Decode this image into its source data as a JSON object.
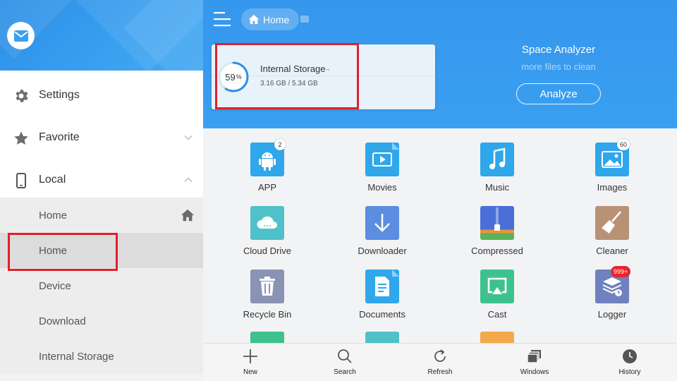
{
  "sidebar": {
    "items": [
      {
        "label": "Settings",
        "icon": "gear-icon"
      },
      {
        "label": "Favorite",
        "icon": "star-icon"
      },
      {
        "label": "Local",
        "icon": "phone-icon"
      }
    ],
    "local_children": [
      {
        "label": "Home"
      },
      {
        "label": "Home"
      },
      {
        "label": "Device"
      },
      {
        "label": "Download"
      },
      {
        "label": "Internal Storage"
      }
    ]
  },
  "header": {
    "breadcrumb": "Home"
  },
  "storage": {
    "percent": "59",
    "percent_unit": "%",
    "name": "Internal Storage",
    "arrow": "→",
    "size": "3.16 GB / 5.34 GB",
    "used_fraction": 0.59
  },
  "analyzer": {
    "title": "Space Analyzer",
    "subtitle": "more files to clean",
    "button": "Analyze"
  },
  "grid": [
    {
      "label": "APP",
      "badge": "2",
      "color": "#2fa7ea",
      "icon": "android-icon"
    },
    {
      "label": "Movies",
      "color": "#2fa7ea",
      "icon": "movie-icon"
    },
    {
      "label": "Music",
      "color": "#2fa7ea",
      "icon": "music-icon"
    },
    {
      "label": "Images",
      "badge": "60",
      "color": "#2fa7ea",
      "icon": "image-icon"
    },
    {
      "label": "Cloud Drive",
      "color": "#4fc1c8",
      "icon": "cloud-icon"
    },
    {
      "label": "Downloader",
      "color": "#5b8de0",
      "icon": "download-icon"
    },
    {
      "label": "Compressed",
      "color": "#5672d8",
      "icon": "zip-icon"
    },
    {
      "label": "Cleaner",
      "color": "#b99275",
      "icon": "broom-icon"
    },
    {
      "label": "Recycle Bin",
      "color": "#8a93b3",
      "icon": "trash-icon"
    },
    {
      "label": "Documents",
      "color": "#2fa7ea",
      "icon": "document-icon"
    },
    {
      "label": "Cast",
      "color": "#3ec28d",
      "icon": "cast-icon"
    },
    {
      "label": "Logger",
      "badge": "999+",
      "color": "#6f82bf",
      "icon": "logger-icon"
    }
  ],
  "bottom_nav": [
    {
      "label": "New",
      "icon": "plus-icon"
    },
    {
      "label": "Search",
      "icon": "search-icon"
    },
    {
      "label": "Refresh",
      "icon": "refresh-icon"
    },
    {
      "label": "Windows",
      "icon": "windows-icon"
    },
    {
      "label": "History",
      "icon": "clock-icon"
    }
  ]
}
